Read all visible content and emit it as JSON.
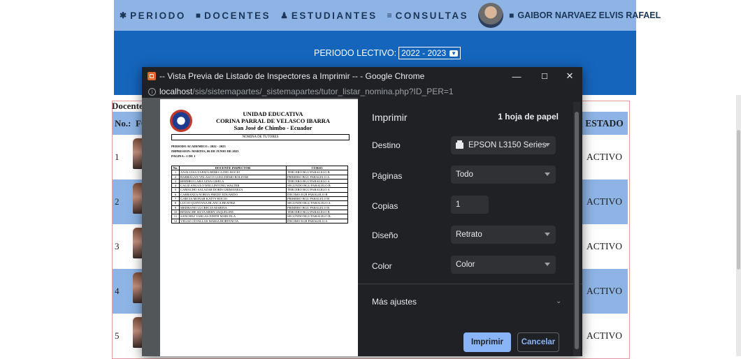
{
  "nav": {
    "items": [
      {
        "icon": "home-icon",
        "glyph": "✱",
        "label": "PERIODO"
      },
      {
        "icon": "book-icon",
        "glyph": "■",
        "label": "DOCENTES"
      },
      {
        "icon": "user-icon",
        "glyph": "♟",
        "label": "ESTUDIANTES"
      },
      {
        "icon": "list-icon",
        "glyph": "≡",
        "label": "CONSULTAS"
      }
    ],
    "user_name": "GAIBOR NARVAEZ ELVIS RAFAEL"
  },
  "periodo": {
    "label": "PERIODO LECTIVO:",
    "selected": "2022 - 2023"
  },
  "background_table": {
    "caption_fragment": "Docente",
    "col_no": "No.:",
    "col_fo": "FO",
    "col_estado": "ESTADO",
    "rows": [
      {
        "no": "1",
        "estado": "ACTIVO"
      },
      {
        "no": "2",
        "estado": "ACTIVO"
      },
      {
        "no": "3",
        "estado": "ACTIVO"
      },
      {
        "no": "4",
        "estado": "ACTIVO"
      },
      {
        "no": "5",
        "estado": "ACTIVO"
      }
    ],
    "fragments": [
      "PI",
      "IN",
      "PA",
      "No",
      "1"
    ]
  },
  "popup": {
    "title": "-- Vista Previa de Listado de Inspectores a Imprimir -- - Google Chrome",
    "url_host": "localhost",
    "url_path": "/sis/sistemapartes/_sistemapartes/tutor_listar_nomina.php?ID_PER=1",
    "controls": {
      "minimize": "—",
      "maximize": "☐",
      "close": "✕"
    }
  },
  "document": {
    "school_line1": "UNIDAD EDUCATIVA",
    "school_line2": "CORINA PARRAL DE VELASCO IBARRA",
    "school_line3": "San José de Chimbo - Ecuador",
    "nomina": "NOMINA DE TUTORES",
    "periodo_line": "PERIODO ACADEMICO : 2022 - 2023",
    "impresion_line": "IMPRESION: MARTES, 06 DE JUNIO DE 2023",
    "pagina_line": "PAGINA    : 1 DE 1",
    "table_headers": [
      "No.",
      "DOCENTE INSPECTOR",
      "CURSO"
    ],
    "table_rows": [
      [
        "1",
        "ANALUISA ZAPATA REBECA DEL ROCIO",
        "TERCERO BGU PARALELO B"
      ],
      [
        "2",
        "BARRAGAN VELASCO GUILLERMO BOLIVAR",
        "PRIMERO BGU PARALELO A"
      ],
      [
        "3",
        "BERMEO LARA GINA GISELA",
        "TERCERO BGU PARALELO A"
      ],
      [
        "4",
        "CALIZ ANGULO WELLINTONG WALTER",
        "SEGUNDO BGU PARALELO B"
      ],
      [
        "5",
        "CAMACHO SALAZAR DORIS GRIMANEZA",
        "TERCERO BGU PARALELO A"
      ],
      [
        "6",
        "CARRANZA NOBOA FREDY EDUARDO",
        "DECIMO EGB PARALELO B"
      ],
      [
        "7",
        "GARCIA MONAR KATTY ROCIO",
        "PRIMERO BGU PARALELO B"
      ],
      [
        "8",
        "LUCIO QUINTANA BLANCA BEATRIZ",
        "SEGUNDO BGU PARALELO A"
      ],
      [
        "9",
        "MEDRANO LUCRECIA MARINA",
        "PRIMERO BGU PARALELO B"
      ],
      [
        "10",
        "REMACHE SILVA MERY JAQUELINE",
        "TERCERO BGU PARALELO B"
      ],
      [
        "11",
        "SANCHEZ VARGAS EDITH MARCELA",
        "SEGUNDO BGU PARALELO B"
      ],
      [
        "12",
        "VELOZ CEVALLOS MARIA HORTENCIA",
        "DECIMO EGB PARALELO A"
      ]
    ]
  },
  "print_settings": {
    "title": "Imprimir",
    "sheets": "1 hoja de papel",
    "destino_label": "Destino",
    "destino_value": "EPSON L3150 Series",
    "paginas_label": "Páginas",
    "paginas_value": "Todo",
    "copias_label": "Copias",
    "copias_value": "1",
    "diseno_label": "Diseño",
    "diseno_value": "Retrato",
    "color_label": "Color",
    "color_value": "Color",
    "mas_ajustes": "Más ajustes",
    "print_button": "Imprimir",
    "cancel_button": "Cancelar"
  },
  "colors": {
    "nav_bg": "#8db4e5",
    "banner_bg": "#1565bd",
    "chrome_dark": "#202124",
    "accent_blue": "#8ab4f8"
  }
}
